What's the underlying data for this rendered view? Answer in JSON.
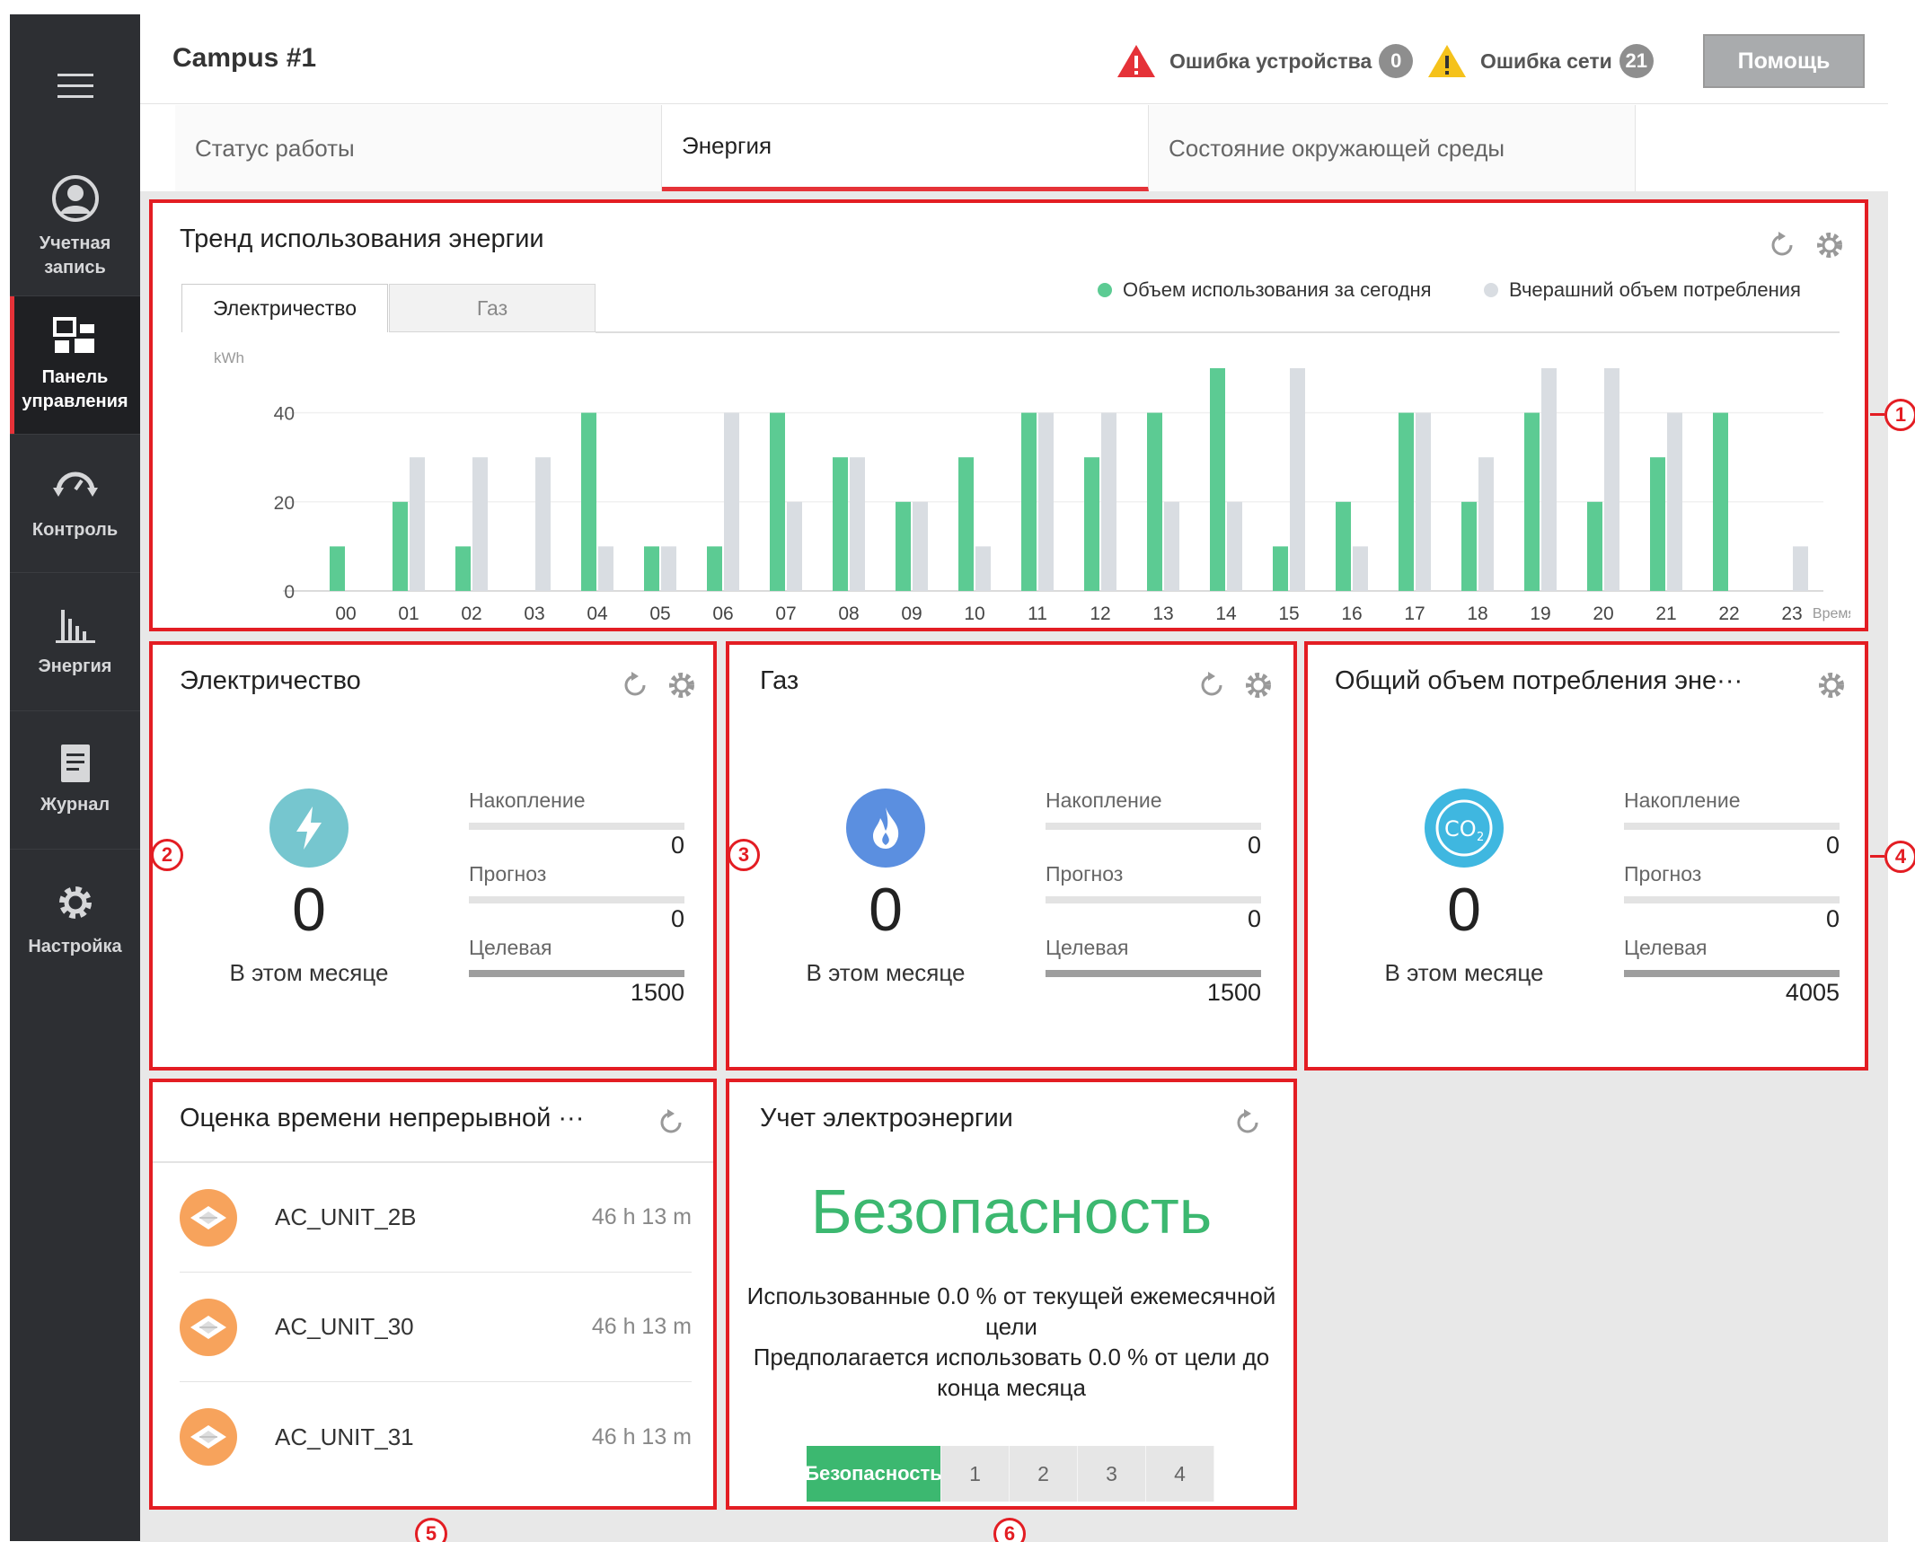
{
  "topbar": {
    "title": "Campus #1",
    "device_error_label": "Ошибка устройства",
    "device_error_count": "0",
    "network_error_label": "Ошибка сети",
    "network_error_count": "21",
    "help_label": "Помощь"
  },
  "sidebar": {
    "items": [
      {
        "label": "Учетная запись"
      },
      {
        "label": "Панель управления"
      },
      {
        "label": "Контроль"
      },
      {
        "label": "Энергия"
      },
      {
        "label": "Журнал"
      },
      {
        "label": "Настройка"
      }
    ]
  },
  "tabs": [
    {
      "label": "Статус работы"
    },
    {
      "label": "Энергия"
    },
    {
      "label": "Состояние окружающей среды"
    }
  ],
  "markers": [
    "1",
    "2",
    "3",
    "4",
    "5",
    "6"
  ],
  "trend": {
    "title": "Тренд использования энергии",
    "tab_electricity": "Электричество",
    "tab_gas": "Газ",
    "legend_today": "Объем использования за сегодня",
    "legend_yesterday": "Вчерашний объем потребления",
    "unit": "kWh",
    "xaxis_label": "Время"
  },
  "chart_data": {
    "type": "bar",
    "categories": [
      "00",
      "01",
      "02",
      "03",
      "04",
      "05",
      "06",
      "07",
      "08",
      "09",
      "10",
      "11",
      "12",
      "13",
      "14",
      "15",
      "16",
      "17",
      "18",
      "19",
      "20",
      "21",
      "22",
      "23"
    ],
    "series": [
      {
        "name": "Объем использования за сегодня",
        "color": "#5ccb93",
        "values": [
          10,
          20,
          10,
          0,
          40,
          10,
          10,
          40,
          30,
          20,
          30,
          40,
          30,
          40,
          50,
          10,
          20,
          40,
          20,
          40,
          20,
          30,
          40,
          0
        ]
      },
      {
        "name": "Вчерашний объем потребления",
        "color": "#d9dde2",
        "values": [
          0,
          30,
          30,
          30,
          10,
          10,
          40,
          20,
          30,
          20,
          10,
          40,
          40,
          20,
          20,
          50,
          10,
          40,
          30,
          50,
          50,
          40,
          0,
          10
        ]
      }
    ],
    "yticks": [
      0,
      20,
      40
    ],
    "ylim": [
      0,
      50
    ],
    "ylabel": "kWh",
    "xlabel": "Время"
  },
  "electricity": {
    "title": "Электричество",
    "value": "0",
    "month_label": "В этом месяце",
    "accum_label": "Накопление",
    "accum_value": "0",
    "forecast_label": "Прогноз",
    "forecast_value": "0",
    "target_label": "Целевая",
    "target_value": "1500"
  },
  "gas": {
    "title": "Газ",
    "value": "0",
    "month_label": "В этом месяце",
    "accum_label": "Накопление",
    "accum_value": "0",
    "forecast_label": "Прогноз",
    "forecast_value": "0",
    "target_label": "Целевая",
    "target_value": "1500"
  },
  "total": {
    "title": "Общий объем потребления эне···",
    "value": "0",
    "month_label": "В этом месяце",
    "accum_label": "Накопление",
    "accum_value": "0",
    "forecast_label": "Прогноз",
    "forecast_value": "0",
    "target_label": "Целевая",
    "target_value": "4005"
  },
  "runtime": {
    "title": "Оценка времени непрерывной ···",
    "rows": [
      {
        "name": "AC_UNIT_2B",
        "time": "46 h 13 m"
      },
      {
        "name": "AC_UNIT_30",
        "time": "46 h 13 m"
      },
      {
        "name": "AC_UNIT_31",
        "time": "46 h 13 m"
      }
    ]
  },
  "meter": {
    "title": "Учет электроэнергии",
    "status": "Безопасность",
    "line1": "Использованные 0.0 % от текущей ежемесячной",
    "line2": "цели",
    "line3": "Предполагается использовать 0.0 % от цели до",
    "line4": "конца месяца",
    "steps": [
      "Безопасность",
      "1",
      "2",
      "3",
      "4"
    ]
  }
}
